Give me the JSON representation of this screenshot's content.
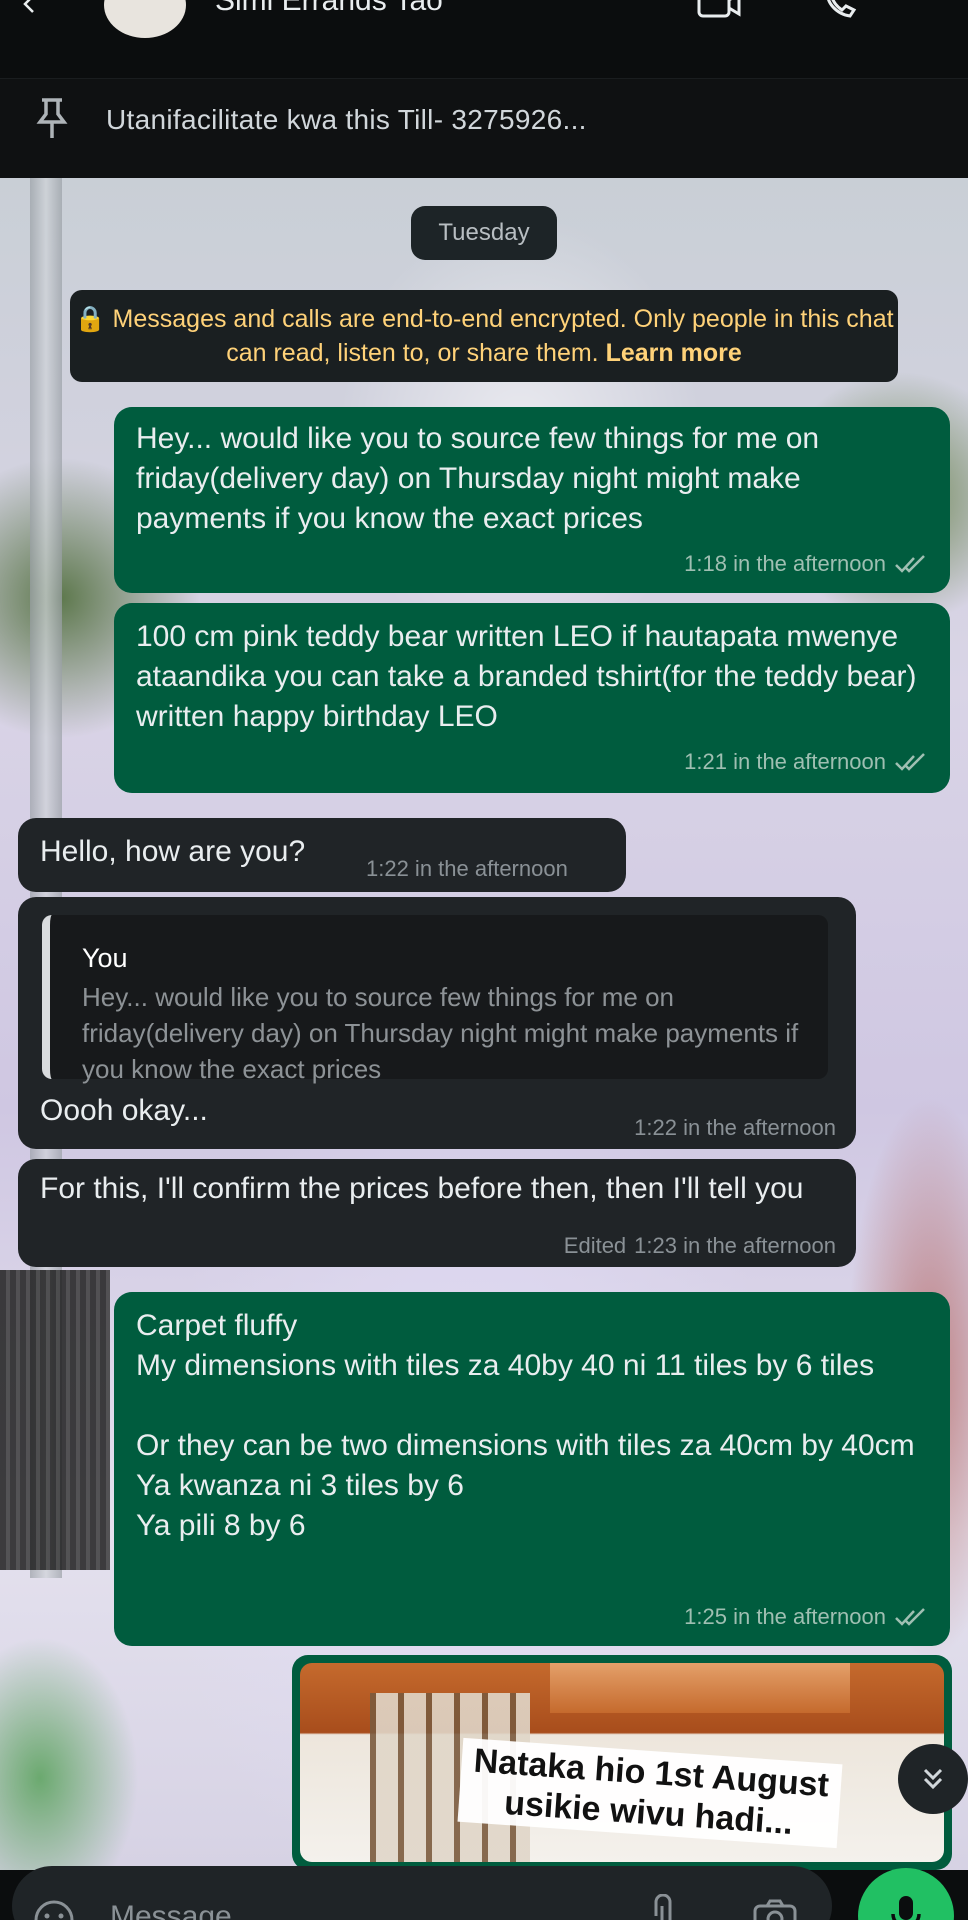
{
  "header": {
    "title": "Simi Errands Tao",
    "pinned_message": "Utanifacilitate kwa this Till- 3275926..."
  },
  "date_chip": "Tuesday",
  "encryption": {
    "text": "Messages and calls are end-to-end encrypted. Only people in this chat can read, listen to, or share them.",
    "link": "Learn more"
  },
  "messages": [
    {
      "direction": "out",
      "text": "Hey... would like you to source few things for me on friday(delivery day) on Thursday night might make payments if you know the exact prices",
      "time": "1:18 in the afternoon",
      "status": "read"
    },
    {
      "direction": "out",
      "text": "100 cm pink teddy bear written LEO if hautapata mwenye ataandika you can take a branded tshirt(for the teddy bear) written happy birthday LEO",
      "time": "1:21 in the afternoon",
      "status": "read"
    },
    {
      "direction": "in",
      "text": "Hello, how are you?",
      "time": "1:22 in the afternoon"
    },
    {
      "direction": "in",
      "quote_author": "You",
      "quote_text": "Hey... would like you to source few things for me on friday(delivery day) on Thursday night might make payments if you know the exact prices",
      "text": "Oooh okay...",
      "time": "1:22 in the afternoon"
    },
    {
      "direction": "in",
      "text": "For this, I'll confirm the prices before then, then I'll tell you",
      "edited_label": "Edited",
      "time": "1:23 in the afternoon"
    },
    {
      "direction": "out",
      "text": "Carpet fluffy\nMy dimensions with tiles za 40by 40 ni 11 tiles by 6 tiles\n\nOr they can be two dimensions with tiles za 40cm by 40cm\nYa kwanza ni 3 tiles by 6\nYa pili 8 by 6",
      "time": "1:25 in the afternoon",
      "status": "read"
    },
    {
      "direction": "out",
      "type": "image",
      "caption": "Nataka hio 1st August usikie wivu hadi..."
    }
  ],
  "composer": {
    "placeholder": "Message"
  },
  "colors": {
    "outgoing_bubble": "#005c3e",
    "incoming_bubble": "#202427",
    "encryption_text": "#ffd279",
    "mic_button": "#21c063"
  },
  "icons": [
    "back-arrow-icon",
    "video-call-icon",
    "phone-icon",
    "pin-icon",
    "lock-icon",
    "double-check-icon",
    "chevrons-down-icon",
    "emoji-icon",
    "attach-icon",
    "camera-icon",
    "mic-icon"
  ]
}
